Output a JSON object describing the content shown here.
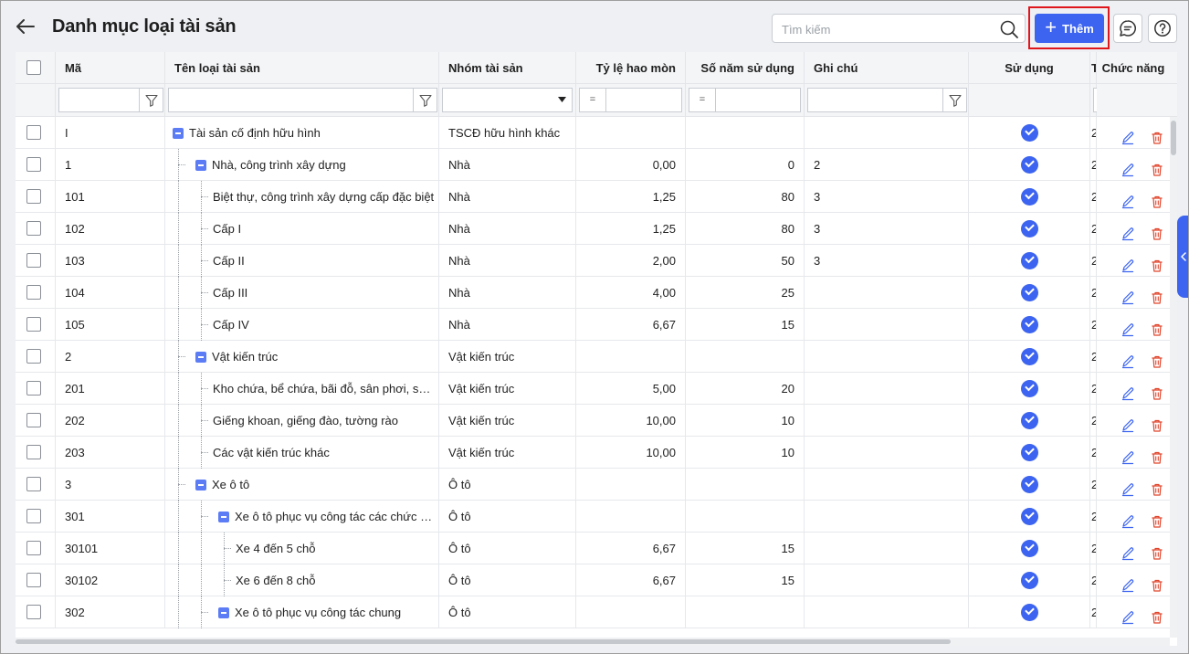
{
  "header": {
    "title": "Danh mục loại tài sản",
    "search_placeholder": "Tìm kiếm",
    "add_label": "Thêm"
  },
  "columns": {
    "code": "Mã",
    "name": "Tên loại tài sản",
    "group": "Nhóm tài sản",
    "rate": "Tỷ lệ hao mòn",
    "years": "Số năm sử dụng",
    "note": "Ghi chú",
    "use": "Sử dụng",
    "extra": "T",
    "actions": "Chức năng"
  },
  "filters": {
    "eq": "="
  },
  "rows": [
    {
      "code": "I",
      "name": "Tài sản cố định hữu hình",
      "level": 0,
      "expand": true,
      "group": "TSCĐ hữu hình khác",
      "rate": "",
      "years": "",
      "note": "",
      "extra": "2"
    },
    {
      "code": "1",
      "name": "Nhà, công trình xây dựng",
      "level": 1,
      "expand": true,
      "group": "Nhà",
      "rate": "0,00",
      "years": "0",
      "note": "2",
      "extra": "2"
    },
    {
      "code": "101",
      "name": "Biệt thự, công trình xây dựng cấp đặc biệt",
      "level": 2,
      "expand": false,
      "group": "Nhà",
      "rate": "1,25",
      "years": "80",
      "note": "3",
      "extra": "2"
    },
    {
      "code": "102",
      "name": "Cấp I",
      "level": 2,
      "expand": false,
      "group": "Nhà",
      "rate": "1,25",
      "years": "80",
      "note": "3",
      "extra": "2"
    },
    {
      "code": "103",
      "name": "Cấp II",
      "level": 2,
      "expand": false,
      "group": "Nhà",
      "rate": "2,00",
      "years": "50",
      "note": "3",
      "extra": "2"
    },
    {
      "code": "104",
      "name": "Cấp III",
      "level": 2,
      "expand": false,
      "group": "Nhà",
      "rate": "4,00",
      "years": "25",
      "note": "",
      "extra": "2"
    },
    {
      "code": "105",
      "name": "Cấp IV",
      "level": 2,
      "expand": false,
      "group": "Nhà",
      "rate": "6,67",
      "years": "15",
      "note": "",
      "extra": "2"
    },
    {
      "code": "2",
      "name": "Vật kiến trúc",
      "level": 1,
      "expand": true,
      "group": "Vật kiến trúc",
      "rate": "",
      "years": "",
      "note": "",
      "extra": "2"
    },
    {
      "code": "201",
      "name": "Kho chứa, bể chứa, bãi đỗ, sân phơi, sân chơi",
      "level": 2,
      "expand": false,
      "group": "Vật kiến trúc",
      "rate": "5,00",
      "years": "20",
      "note": "",
      "extra": "2"
    },
    {
      "code": "202",
      "name": "Giếng khoan, giếng đào, tường rào",
      "level": 2,
      "expand": false,
      "group": "Vật kiến trúc",
      "rate": "10,00",
      "years": "10",
      "note": "",
      "extra": "2"
    },
    {
      "code": "203",
      "name": "Các vật kiến trúc khác",
      "level": 2,
      "expand": false,
      "group": "Vật kiến trúc",
      "rate": "10,00",
      "years": "10",
      "note": "",
      "extra": "2"
    },
    {
      "code": "3",
      "name": "Xe ô tô",
      "level": 1,
      "expand": true,
      "group": "Ô tô",
      "rate": "",
      "years": "",
      "note": "",
      "extra": "2"
    },
    {
      "code": "301",
      "name": "Xe ô tô phục vụ công tác các chức danh",
      "level": 2,
      "expand": true,
      "group": "Ô tô",
      "rate": "",
      "years": "",
      "note": "",
      "extra": "2"
    },
    {
      "code": "30101",
      "name": "Xe 4 đến 5 chỗ",
      "level": 3,
      "expand": false,
      "group": "Ô tô",
      "rate": "6,67",
      "years": "15",
      "note": "",
      "extra": "2"
    },
    {
      "code": "30102",
      "name": "Xe 6 đến 8 chỗ",
      "level": 3,
      "expand": false,
      "group": "Ô tô",
      "rate": "6,67",
      "years": "15",
      "note": "",
      "extra": "2"
    },
    {
      "code": "302",
      "name": "Xe ô tô phục vụ công tác chung",
      "level": 2,
      "expand": true,
      "group": "Ô tô",
      "rate": "",
      "years": "",
      "note": "",
      "extra": "2"
    }
  ],
  "colors": {
    "accent": "#3c64f0",
    "delete": "#e0442b",
    "highlight": "#e0161d"
  }
}
